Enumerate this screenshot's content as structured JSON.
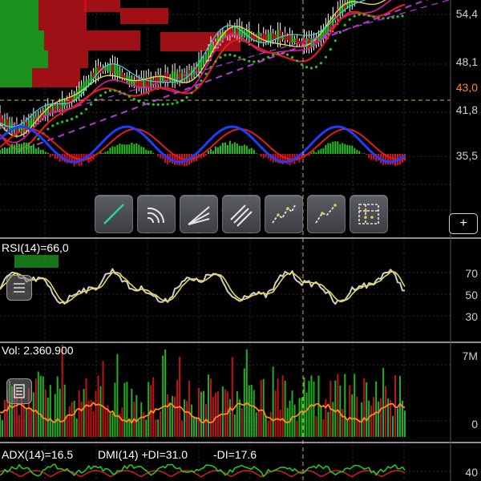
{
  "price_axis": {
    "labels": [
      "54,4",
      "48,1",
      "43,0",
      "41,8",
      "35,5"
    ],
    "highlight_color": "#ff8a1e"
  },
  "rsi": {
    "title": "RSI(14)=66,0",
    "axis": [
      "70",
      "50",
      "30"
    ]
  },
  "volume": {
    "title": "Vol: 2.360.900",
    "axis": [
      "7M",
      "0"
    ]
  },
  "adx": {
    "title_adx": "ADX(14)=16.5",
    "title_dmi": "DMI(14) +DI=31.0",
    "title_minus": "-DI=17.6",
    "axis": [
      "40"
    ]
  },
  "toolbar": {
    "icons": [
      "trendline-icon",
      "fibonacci-arc-icon",
      "fibonacci-fan-icon",
      "parallel-channel-icon",
      "elliott-wave-icon",
      "pitchfork-icon",
      "grid-icon"
    ],
    "add_label": "+"
  },
  "colors": {
    "background": "#000000",
    "up": "#27c227",
    "down": "#d4141e",
    "blue": "#1f3cff",
    "red": "#e01c1c",
    "yellow": "#e6d94c",
    "orange": "#ff8a1e",
    "magenta": "#e2189a",
    "cyan": "#39d6e6",
    "grid": "#3a3a3a"
  }
}
